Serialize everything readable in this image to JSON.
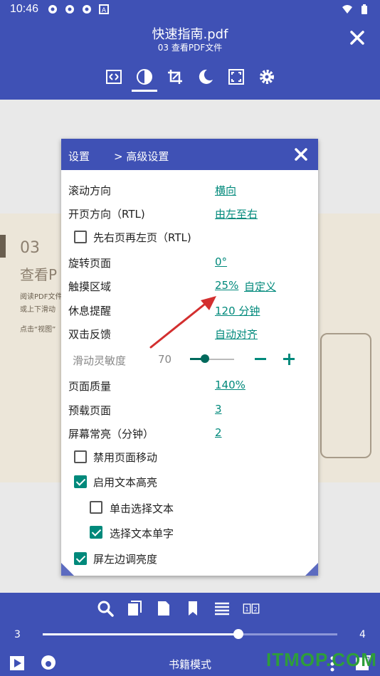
{
  "status_bar": {
    "time": "10:46",
    "notification_icons": [
      "settings-icon",
      "settings-icon",
      "settings-icon",
      "a-badge-icon"
    ],
    "right_icons": [
      "wifi-icon",
      "battery-icon"
    ]
  },
  "header": {
    "title": "快速指南.pdf",
    "subtitle": "03 查看PDF文件",
    "close_icon": "close-icon",
    "toolbar": [
      "fit-width-icon",
      "contrast-icon",
      "crop-icon",
      "night-mode-icon",
      "fullscreen-icon",
      "settings-gear-icon"
    ],
    "active_tool": "contrast-icon"
  },
  "page": {
    "number": "03",
    "heading": "查看P",
    "line1": "阅读PDF文件",
    "line2": "或上下滑动",
    "line3": "点击“视图”"
  },
  "dialog": {
    "breadcrumb_root": "设置",
    "breadcrumb_current": "> 高级设置",
    "settings": [
      {
        "label": "滚动方向",
        "value": "横向"
      },
      {
        "label": "开页方向（RTL)",
        "value": "由左至右"
      },
      {
        "label": "旋转页面",
        "value": "0°"
      },
      {
        "label": "触摸区域",
        "value": "25%",
        "extra": "自定义"
      },
      {
        "label": "休息提醒",
        "value": "120 分钟"
      },
      {
        "label": "双击反馈",
        "value": "自动对齐"
      },
      {
        "label": "页面质量",
        "value": "140%"
      },
      {
        "label": "预载页面",
        "value": "3"
      },
      {
        "label": "屏幕常亮（分钟）",
        "value": "2"
      }
    ],
    "rtl_checkbox": {
      "label": "先右页再左页（RTL)",
      "checked": false
    },
    "sensitivity": {
      "label": "滑动灵敏度",
      "value": "70",
      "level": 0.3
    },
    "checkboxes": [
      {
        "label": "禁用页面移动",
        "checked": false
      },
      {
        "label": "启用文本高亮",
        "checked": true
      },
      {
        "label": "单击选择文本",
        "checked": false
      },
      {
        "label": "选择文本单字",
        "checked": true
      },
      {
        "label": "屏左边调亮度",
        "checked": true
      }
    ]
  },
  "bottom_bar": {
    "tools": [
      "search-icon",
      "pages-icon",
      "page-icon",
      "bookmark-icon",
      "list-icon",
      "two-page-icon"
    ],
    "page_start": "3",
    "page_end": "4",
    "progress": 0.66,
    "mode_label": "书籍模式"
  },
  "watermark": "ITMOP.COM",
  "colors": {
    "primary": "#3f51b5",
    "accent": "#00897b",
    "arrow": "#d32f2f"
  }
}
